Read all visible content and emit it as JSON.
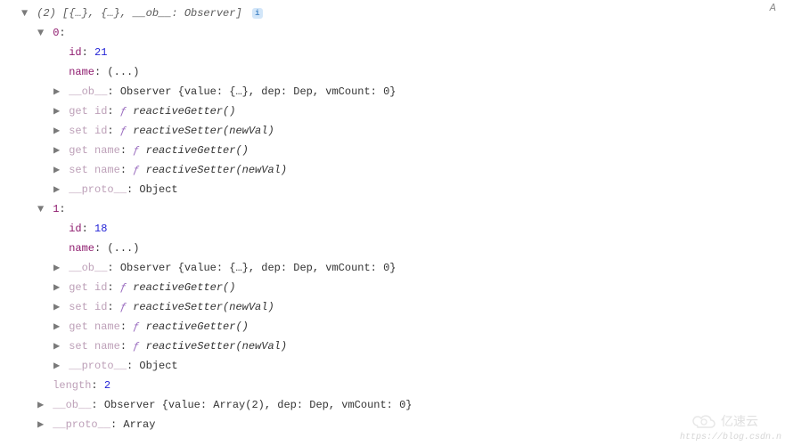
{
  "topRightChar": "A",
  "root": {
    "summarySuffix": "]",
    "summary": "(2) [{…}, {…}, __ob__: Observer]",
    "infoBadge": "i"
  },
  "item0": {
    "index": "0",
    "id_key": "id",
    "id_val": "21",
    "name_key": "name",
    "name_val": "(...)",
    "ob_key": "__ob__",
    "ob_val": "Observer {value: {…}, dep: Dep, vmCount: 0}",
    "get_id_prefix": "get ",
    "get_id_key": "id",
    "get_id_fn": "reactiveGetter()",
    "set_id_prefix": "set ",
    "set_id_key": "id",
    "set_id_fn": "reactiveSetter(newVal)",
    "get_name_prefix": "get ",
    "get_name_key": "name",
    "get_name_fn": "reactiveGetter()",
    "set_name_prefix": "set ",
    "set_name_key": "name",
    "set_name_fn": "reactiveSetter(newVal)",
    "proto_key": "__proto__",
    "proto_val": "Object"
  },
  "item1": {
    "index": "1",
    "id_key": "id",
    "id_val": "18",
    "name_key": "name",
    "name_val": "(...)",
    "ob_key": "__ob__",
    "ob_val": "Observer {value: {…}, dep: Dep, vmCount: 0}",
    "get_id_prefix": "get ",
    "get_id_key": "id",
    "get_id_fn": "reactiveGetter()",
    "set_id_prefix": "set ",
    "set_id_key": "id",
    "set_id_fn": "reactiveSetter(newVal)",
    "get_name_prefix": "get ",
    "get_name_key": "name",
    "get_name_fn": "reactiveGetter()",
    "set_name_prefix": "set ",
    "set_name_key": "name",
    "set_name_fn": "reactiveSetter(newVal)",
    "proto_key": "__proto__",
    "proto_val": "Object"
  },
  "array": {
    "length_key": "length",
    "length_val": "2",
    "ob_key": "__ob__",
    "ob_val": "Observer {value: Array(2), dep: Dep, vmCount: 0}",
    "proto_key": "__proto__",
    "proto_val": "Array"
  },
  "fnF": "ƒ",
  "watermarkUrl": "https://blog.csdn.n",
  "logoText": "亿速云"
}
